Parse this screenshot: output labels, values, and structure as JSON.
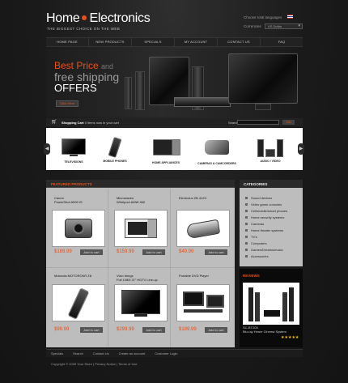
{
  "header": {
    "logo_home": "Home",
    "logo_electronics": "Electronics",
    "tagline": "THE BIGGEST CHOICE ON THE WEB",
    "languages_label": "Choose total languages",
    "currencies_label": "Currencies",
    "currency_value": "US Dollar"
  },
  "nav": [
    "HOME PAGE",
    "NEW PRODUCTS",
    "SPECIALS",
    "MY ACCOUNT",
    "CONTACT US",
    "FAQ"
  ],
  "banner": {
    "line1": "Best Price",
    "line1_suffix": "and",
    "line2": "free shipping",
    "line3": "OFFERS",
    "button": "Click Here"
  },
  "cart": {
    "label": "Shopping Cart",
    "text": "now in your cart",
    "count": "0 items",
    "search_label": "Search:",
    "go": "Go"
  },
  "category_strip": [
    {
      "label": "TELEVISIONS",
      "icon": "tv-icon"
    },
    {
      "label": "MOBILE PHONES",
      "icon": "phone-icon"
    },
    {
      "label": "HOME APPLIANCES",
      "icon": "microwave-icon"
    },
    {
      "label": "CAMERAS & CAMCORDERS",
      "icon": "camcorder-icon"
    },
    {
      "label": "AUDIO / VIDEO",
      "icon": "audio-icon"
    }
  ],
  "featured": {
    "title": "FEATURED PRODUCTS",
    "add_label": "Add to cart",
    "products": [
      {
        "name1": "Canon",
        "name2": "PowerShot A590 IS",
        "price": "$189.99"
      },
      {
        "name1": "Microwaves",
        "name2": "Whirlpool AMW 460",
        "price": "$159.99"
      },
      {
        "name1": "Electrolux ZB 412C",
        "name2": "",
        "price": "$49.99"
      },
      {
        "name1": "Motorola MOTOROKR Z8",
        "name2": "",
        "price": "$99.99"
      },
      {
        "name1": "Vizio brings",
        "name2": "Full 1080i 37\" HDTV Line-up",
        "price": "$299.99"
      },
      {
        "name1": "Portable DVD Player",
        "name2": "",
        "price": "$189.99"
      }
    ]
  },
  "categories": {
    "title": "CATEGORIES",
    "items": [
      "Sound devices",
      "Video game consoles",
      "Cell/mobile/smart phones",
      "Home security systems",
      "Cameras",
      "Home theater systems",
      "TV's",
      "Computers",
      "Games/Dreams/music",
      "Accessories"
    ]
  },
  "reviews": {
    "title": "REVIEWS",
    "product_line1": "SC-BT205",
    "product_line2": "Blu-ray Home Cinema System",
    "stars": "★★★★★",
    "rating": 5
  },
  "footer": {
    "links": [
      "Specials",
      "Search",
      "Contact Us",
      "Create an account",
      "Customer Login"
    ],
    "copyright": "Copyright © 2009 Your Store  |  Privacy Notice  |  Terms of Use"
  },
  "colors": {
    "accent": "#e8501a",
    "panel": "#bdbdbd",
    "dark": "#1a1a1a"
  }
}
